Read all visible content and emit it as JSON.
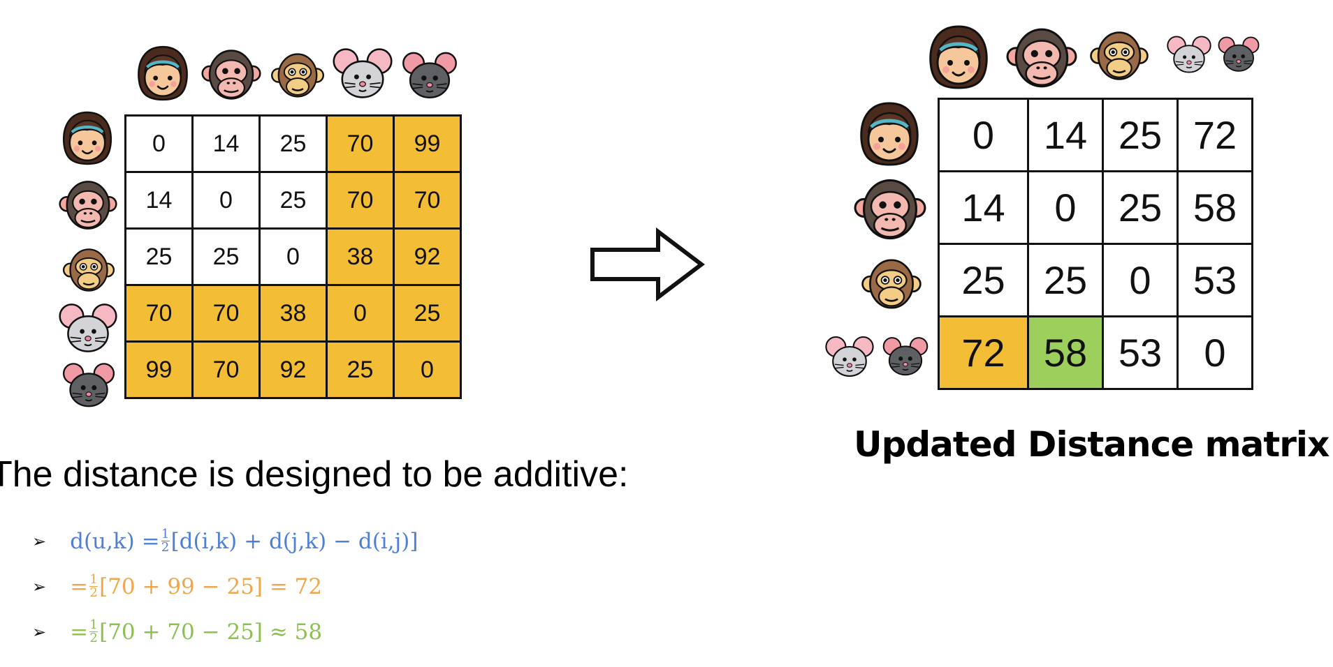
{
  "original_matrix": {
    "rows": [
      [
        "0",
        "14",
        "25",
        "70",
        "99"
      ],
      [
        "14",
        "0",
        "25",
        "70",
        "70"
      ],
      [
        "25",
        "25",
        "0",
        "38",
        "92"
      ],
      [
        "70",
        "70",
        "38",
        "0",
        "25"
      ],
      [
        "99",
        "70",
        "92",
        "25",
        "0"
      ]
    ],
    "highlight_color": "#f4bd36"
  },
  "updated_matrix": {
    "rows": [
      [
        "0",
        "14",
        "25",
        "72"
      ],
      [
        "14",
        "0",
        "25",
        "58"
      ],
      [
        "25",
        "25",
        "0",
        "53"
      ],
      [
        "72",
        "58",
        "53",
        "0"
      ]
    ],
    "highlight_colors": {
      "orange": "#f4bd36",
      "green": "#9ccf5c"
    }
  },
  "updated_title": "Updated Distance matrix",
  "additive_heading": "The distance is designed to be additive:",
  "bullet_char": "➢",
  "equations": {
    "formula": {
      "lhs": "d(u,k) =",
      "num": "1",
      "den": "2",
      "rhs": "[d(i,k) + d(j,k) − d(i,j)]",
      "color": "#4f7fd8"
    },
    "orange": {
      "lhs": "=",
      "num": "1",
      "den": "2",
      "rhs": "[70 + 99 − 25] = 72",
      "color": "#f0a64a"
    },
    "green": {
      "lhs": "=",
      "num": "1",
      "den": "2",
      "rhs": "[70 + 70 − 25] ≈ 58",
      "color": "#8cc04f"
    }
  },
  "species_icons": [
    "girl-face-icon",
    "chimpanzee-face-icon",
    "monkey-face-icon",
    "gray-mouse-face-icon",
    "dark-mouse-face-icon"
  ]
}
